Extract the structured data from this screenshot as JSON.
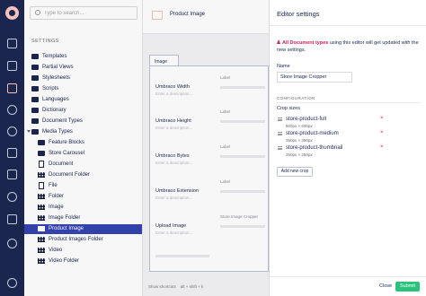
{
  "tree": {
    "search_placeholder": "Type to search...",
    "section_title": "SETTINGS",
    "items": [
      {
        "label": "Templates",
        "icon": "folder-icon"
      },
      {
        "label": "Partial Views",
        "icon": "folder-icon"
      },
      {
        "label": "Stylesheets",
        "icon": "folder-icon"
      },
      {
        "label": "Scripts",
        "icon": "folder-icon"
      },
      {
        "label": "Languages",
        "icon": "folder-icon"
      },
      {
        "label": "Dictionary",
        "icon": "folder-icon"
      },
      {
        "label": "Document Types",
        "icon": "folder-icon"
      },
      {
        "label": "Media Types",
        "icon": "folder-icon"
      },
      {
        "label": "Feature Blocks",
        "icon": "folder-icon"
      },
      {
        "label": "Store Carousel",
        "icon": "folder-icon"
      },
      {
        "label": "Document",
        "icon": "document-icon"
      },
      {
        "label": "Document Folder",
        "icon": "grid-icon"
      },
      {
        "label": "File",
        "icon": "document-icon"
      },
      {
        "label": "Folder",
        "icon": "grid-icon"
      },
      {
        "label": "Image",
        "icon": "grid-icon"
      },
      {
        "label": "Image Folder",
        "icon": "grid-icon"
      },
      {
        "label": "Product Image",
        "icon": "grid-icon"
      },
      {
        "label": "Product Images Folder",
        "icon": "grid-icon"
      },
      {
        "label": "Video",
        "icon": "grid-icon"
      },
      {
        "label": "Video Folder",
        "icon": "grid-icon"
      }
    ],
    "selected": "Product Image"
  },
  "editor": {
    "name": "Product Image",
    "tab": "Image",
    "properties": [
      {
        "name": "Umbraco Width",
        "desc": "Enter a description...",
        "label": "Label"
      },
      {
        "name": "Umbraco Height",
        "desc": "Enter a description...",
        "label": "Label"
      },
      {
        "name": "Umbraco Bytes",
        "desc": "Enter a description...",
        "label": "Label"
      },
      {
        "name": "Umbraco Extension",
        "desc": "Enter a description...",
        "label": "Label"
      },
      {
        "name": "Upload Image",
        "desc": "Enter a description...",
        "label": "Store Image Cropper"
      }
    ],
    "footer": {
      "shortcuts": "Show shortcuts",
      "keys": "alt + shift + k"
    }
  },
  "overlay": {
    "title": "Editor settings",
    "warning_bold": "All Document types",
    "warning_text": "using this editor will get updated with the new settings.",
    "name_label": "Name",
    "name_value": "Store Image Cropper",
    "config_title": "CONFIGURATION",
    "crop_label": "Crop sizes",
    "crops": [
      {
        "name": "store-product-full",
        "dims": "600px × 600px"
      },
      {
        "name": "store-product-medium",
        "dims": "350px × 350px"
      },
      {
        "name": "store-product-thumbnail",
        "dims": "250px × 250px"
      }
    ],
    "delete_glyph": "×",
    "add_crop": "Add new crop",
    "close": "Close",
    "submit": "Submit"
  },
  "colors": {
    "section_bar": "#1b264f",
    "accent_pink": "#f5c1bc",
    "selected": "#3544b1",
    "danger": "#d42054",
    "submit": "#2bc37c"
  }
}
